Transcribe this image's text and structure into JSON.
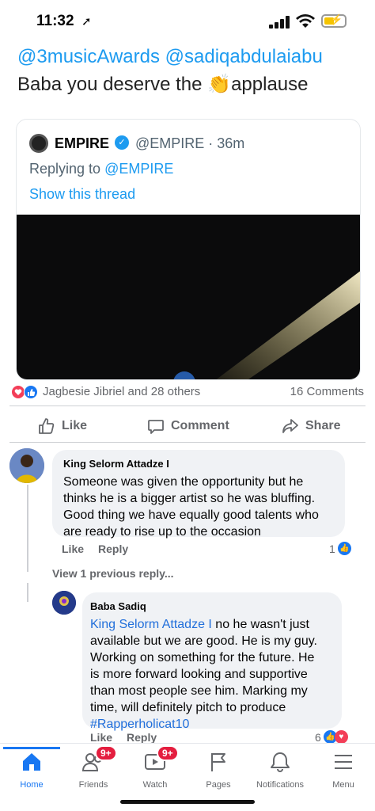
{
  "status_bar": {
    "time": "11:32",
    "location_arrow": "➚"
  },
  "tweet": {
    "mentions": "@3musicAwards @sadiqabdulaiabu",
    "text_before": "Baba you deserve the ",
    "emoji": "👏",
    "text_after": "applause",
    "quote": {
      "name": "EMPIRE",
      "handle": "@EMPIRE · 36m",
      "replying_prefix": "Replying to ",
      "replying_handle": "@EMPIRE",
      "show_thread": "Show this thread"
    }
  },
  "reactions": {
    "summary": "Jagbesie Jibriel and 28 others",
    "comments": "16 Comments"
  },
  "actions": {
    "like": "Like",
    "comment": "Comment",
    "share": "Share"
  },
  "comments": [
    {
      "author": "King Selorm Attadze I",
      "lines": [
        "Someone was given the opportunity but he",
        "thinks he is a bigger artist so he was bluffing.",
        "Good thing we have equally good talents who",
        "are ready to rise up to the occasion"
      ],
      "like": "Like",
      "reply": "Reply",
      "like_count": "1"
    },
    {
      "author": "Baba Sadiq",
      "mention": "King Selorm Attadze I",
      "first_line_rest": " no he wasn't just",
      "lines": [
        "available but we are good. He is my guy.",
        "Working on something for the future. He",
        "is more forward looking and supportive",
        "than most people see him. Marking my",
        "time, will definitely pitch to produce"
      ],
      "hashtag": "#Rapperholicat10",
      "like": "Like",
      "reply": "Reply",
      "like_count": "6"
    }
  ],
  "view_previous": "View 1 previous reply...",
  "bottom_nav": [
    {
      "label": "Home",
      "icon": "home-icon",
      "active": true
    },
    {
      "label": "Friends",
      "icon": "friends-icon",
      "badge": "9+"
    },
    {
      "label": "Watch",
      "icon": "watch-icon",
      "badge": "9+"
    },
    {
      "label": "Pages",
      "icon": "flag-icon"
    },
    {
      "label": "Notifications",
      "icon": "bell-icon"
    },
    {
      "label": "Menu",
      "icon": "menu-icon"
    }
  ],
  "colors": {
    "twitter_blue": "#1d9bf0",
    "facebook_blue": "#1877f2",
    "badge_red": "#e41e3f"
  }
}
